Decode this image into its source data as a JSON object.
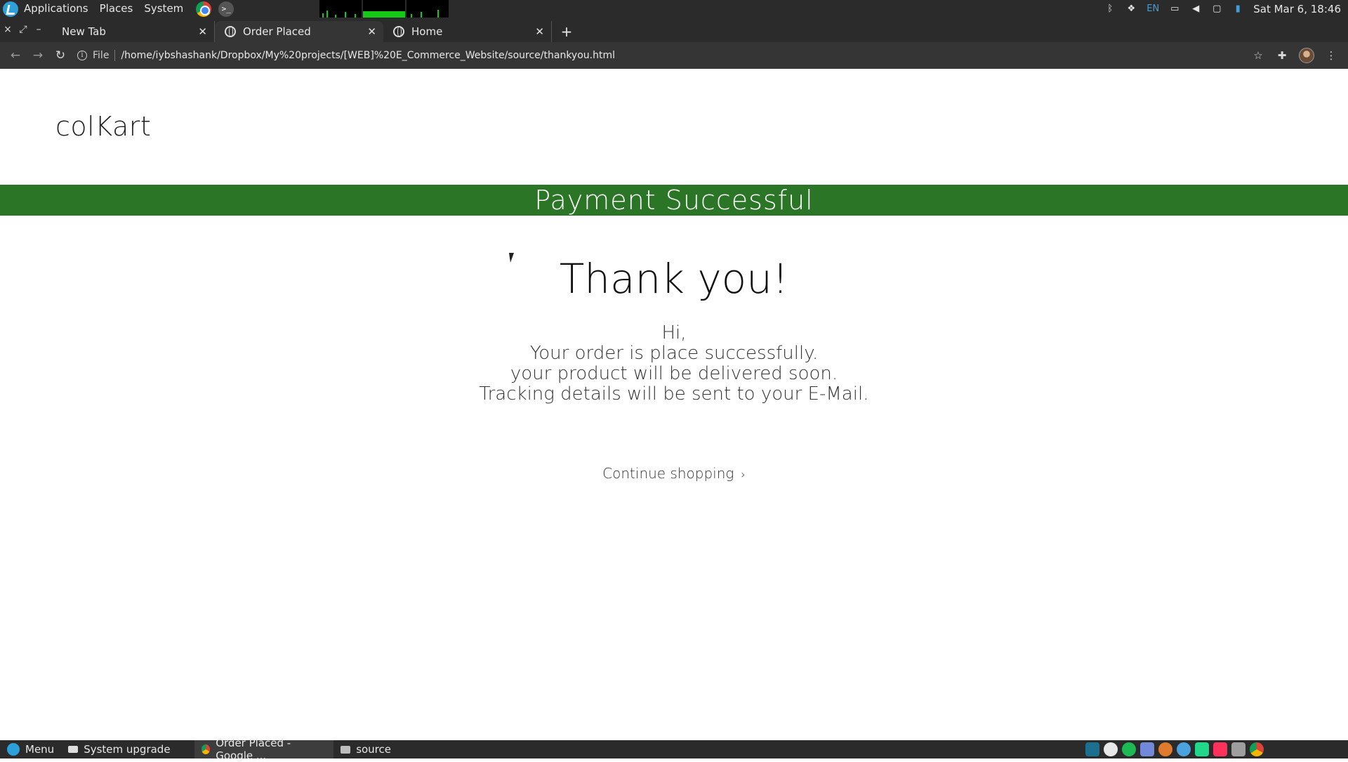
{
  "top_panel": {
    "menus": [
      "Applications",
      "Places",
      "System"
    ],
    "language": "EN",
    "clock": "Sat Mar  6, 18:46"
  },
  "tabs": [
    {
      "title": "New Tab",
      "active": false
    },
    {
      "title": "Order Placed",
      "active": true
    },
    {
      "title": "Home",
      "active": false
    }
  ],
  "address_bar": {
    "scheme_label": "File",
    "url": "/home/iybshashank/Dropbox/My%20projects/[WEB]%20E_Commerce_Website/source/thankyou.html"
  },
  "page": {
    "brand": "colKart",
    "banner": "Payment Successful",
    "heading": "Thank you!",
    "message_lines": [
      "Hi,",
      "Your order is place successfully.",
      "your product will be delivered soon.",
      "Tracking details will be sent to your E-Mail."
    ],
    "continue_label": "Continue shopping",
    "continue_chevron": "›"
  },
  "taskbar": {
    "menu_label": "Menu",
    "items": [
      {
        "label": "System upgrade",
        "icon": "document-icon"
      },
      {
        "label": "Order Placed - Google ...",
        "icon": "chrome-icon",
        "active": true
      },
      {
        "label": "source",
        "icon": "folder-icon"
      }
    ]
  },
  "colors": {
    "banner": "#2a7526",
    "panel": "#2b2b2b",
    "toolbar": "#353535"
  }
}
